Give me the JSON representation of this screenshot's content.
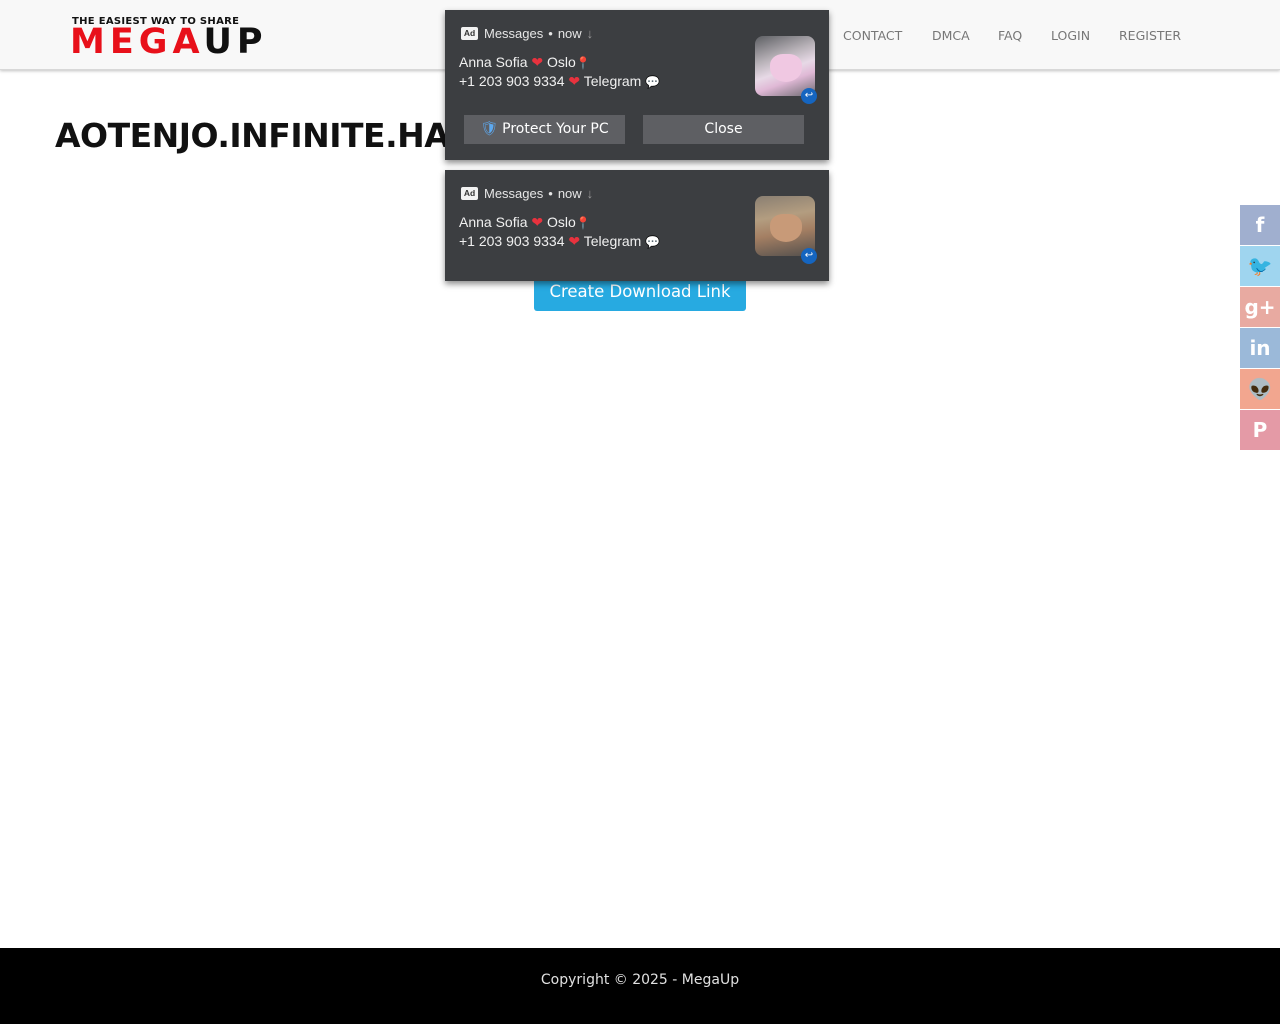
{
  "header": {
    "logo": {
      "tagline": "THE EASIEST WAY TO SHARE",
      "word_red": "MEGA",
      "word_black": "UP"
    },
    "nav": [
      {
        "label": "CONTACT"
      },
      {
        "label": "DMCA"
      },
      {
        "label": "FAQ"
      },
      {
        "label": "LOGIN"
      },
      {
        "label": "REGISTER"
      }
    ]
  },
  "main": {
    "title": "AOTENJO.INFINITE.HAN",
    "download_button": "Create Download Link"
  },
  "notifications": [
    {
      "ad_label": "Ad",
      "source": "Messages",
      "separator": "•",
      "time": "now",
      "arrow": "↓",
      "name": "Anna Sofia",
      "city": "Oslo",
      "phone": "+1 203 903 9334",
      "app": "Telegram",
      "thumbnail": "photo-thumbnail-1",
      "buttons": {
        "protect": "Protect Your PC",
        "close": "Close"
      }
    },
    {
      "ad_label": "Ad",
      "source": "Messages",
      "separator": "•",
      "time": "now",
      "arrow": "↓",
      "name": "Anna Sofia",
      "city": "Oslo",
      "phone": "+1 203 903 9334",
      "app": "Telegram",
      "thumbnail": "photo-thumbnail-2"
    }
  ],
  "share_sidebar": [
    {
      "network": "facebook",
      "glyph": "f",
      "color": "#a0afcf"
    },
    {
      "network": "twitter",
      "glyph": "🐦",
      "color": "#9fd5ef"
    },
    {
      "network": "google-plus",
      "glyph": "g+",
      "color": "#e8aaa1"
    },
    {
      "network": "linkedin",
      "glyph": "in",
      "color": "#9bb9d9"
    },
    {
      "network": "reddit",
      "glyph": "👽",
      "color": "#f2a68f"
    },
    {
      "network": "pinterest",
      "glyph": "P",
      "color": "#e49aa6"
    }
  ],
  "footer": {
    "copyright": "Copyright © 2025 - MegaUp"
  },
  "colors": {
    "brand_red": "#e8101a",
    "button_blue": "#27aae1",
    "notif_bg": "#3c3e41"
  }
}
